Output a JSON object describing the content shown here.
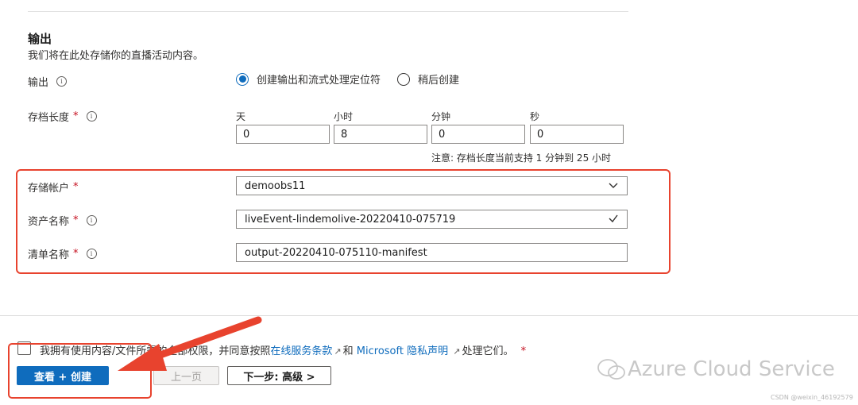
{
  "output_section": {
    "title": "输出",
    "description": "我们将在此处存储你的直播活动内容。"
  },
  "output_field": {
    "label": "输出",
    "info_icon": "info-icon",
    "options": [
      {
        "label": "创建输出和流式处理定位符",
        "selected": true
      },
      {
        "label": "稍后创建",
        "selected": false
      }
    ]
  },
  "archive": {
    "label": "存档长度",
    "required_mark": "*",
    "units": [
      {
        "label": "天",
        "value": "0"
      },
      {
        "label": "小时",
        "value": "8"
      },
      {
        "label": "分钟",
        "value": "0"
      },
      {
        "label": "秒",
        "value": "0"
      }
    ],
    "note": "注意: 存档长度当前支持 1 分钟到 25 小时"
  },
  "storage_account": {
    "label": "存储帐户",
    "required_mark": "*",
    "value": "demoobs11",
    "icon": "chevron-down-icon"
  },
  "asset_name": {
    "label": "资产名称",
    "required_mark": "*",
    "value": "liveEvent-lindemolive-20220410-075719",
    "icon": "checkmark-icon"
  },
  "manifest_name": {
    "label": "清单名称",
    "required_mark": "*",
    "value": "output-20220410-075110-manifest"
  },
  "consent": {
    "text_before": "我拥有使用内容/文件所需的全部权限，并同意按照",
    "link1": "在线服务条款",
    "text_mid": "和",
    "link2": "Microsoft 隐私声明",
    "text_after": "处理它们。",
    "required_mark": "*"
  },
  "buttons": {
    "review_create": "查看 + 创建",
    "previous": "上一页",
    "next": "下一步: 高级 >"
  },
  "watermark": {
    "text": "Azure Cloud Service",
    "tag": "CSDN @weixin_46192579"
  },
  "colors": {
    "accent": "#0f6cbd",
    "annotation": "#e8432e"
  }
}
